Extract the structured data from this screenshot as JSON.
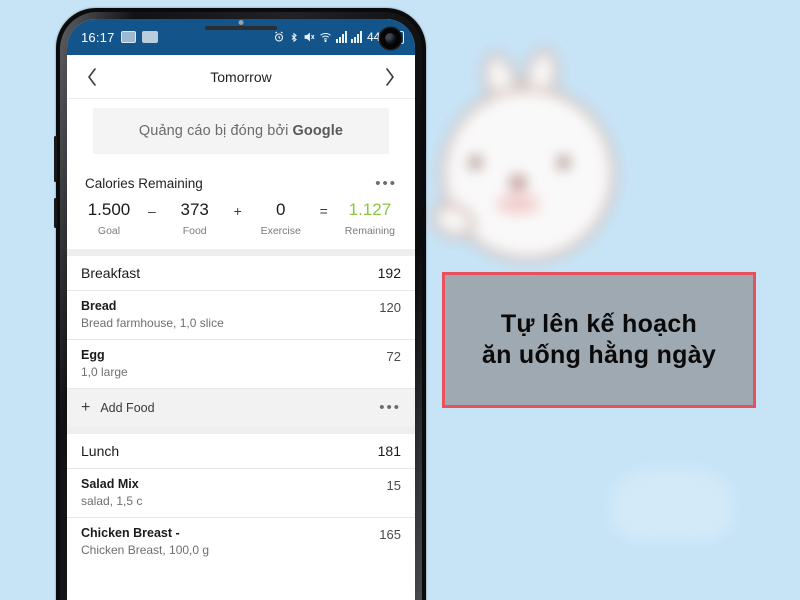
{
  "background": {
    "color": "#c7e4f7",
    "mascot_alt": "blurred-white-cartoon-rabbit"
  },
  "phone": {
    "statusbar": {
      "time": "16:17",
      "battery_percent": "44%",
      "icons": [
        "photo-icon",
        "screenshot-icon",
        "alarm-icon",
        "bluetooth-icon",
        "mute-icon",
        "wifi-icon",
        "signal-icon",
        "signal2-icon",
        "battery-icon"
      ],
      "background_color": "#13548a"
    },
    "appbar": {
      "prev_label": "‹",
      "title": "Tomorrow",
      "next_label": "›"
    },
    "ad": {
      "text_prefix": "Quảng cáo bị đóng bởi ",
      "brand": "Google",
      "full_text": "Quảng cáo bị đóng bởi Google"
    },
    "calories": {
      "title": "Calories Remaining",
      "menu": "•••",
      "cells": [
        {
          "value": "1.500",
          "label": "Goal"
        },
        {
          "value": "373",
          "label": "Food"
        },
        {
          "value": "0",
          "label": "Exercise"
        },
        {
          "value": "1.127",
          "label": "Remaining"
        }
      ],
      "operators": [
        "–",
        "+",
        "="
      ],
      "remaining_color": "#8cc63f"
    },
    "meals": [
      {
        "name": "Breakfast",
        "calories": "192",
        "foods": [
          {
            "name": "Bread",
            "desc": "Bread farmhouse, 1,0 slice",
            "calories": "120"
          },
          {
            "name": "Egg",
            "desc": "1,0 large",
            "calories": "72"
          }
        ],
        "add_food_label": "Add Food",
        "add_food_plus": "+",
        "add_food_menu": "•••"
      },
      {
        "name": "Lunch",
        "calories": "181",
        "foods": [
          {
            "name": "Salad Mix",
            "desc": "salad, 1,5 c",
            "calories": "15"
          },
          {
            "name": "Chicken Breast -",
            "desc": "Chicken Breast, 100,0 g",
            "calories": "165"
          }
        ]
      }
    ]
  },
  "annotation": {
    "line1": "Tự lên kế hoạch",
    "line2": "ăn uống hằng ngày",
    "border_color": "#e8505b",
    "panel_color": "#969ca1"
  }
}
